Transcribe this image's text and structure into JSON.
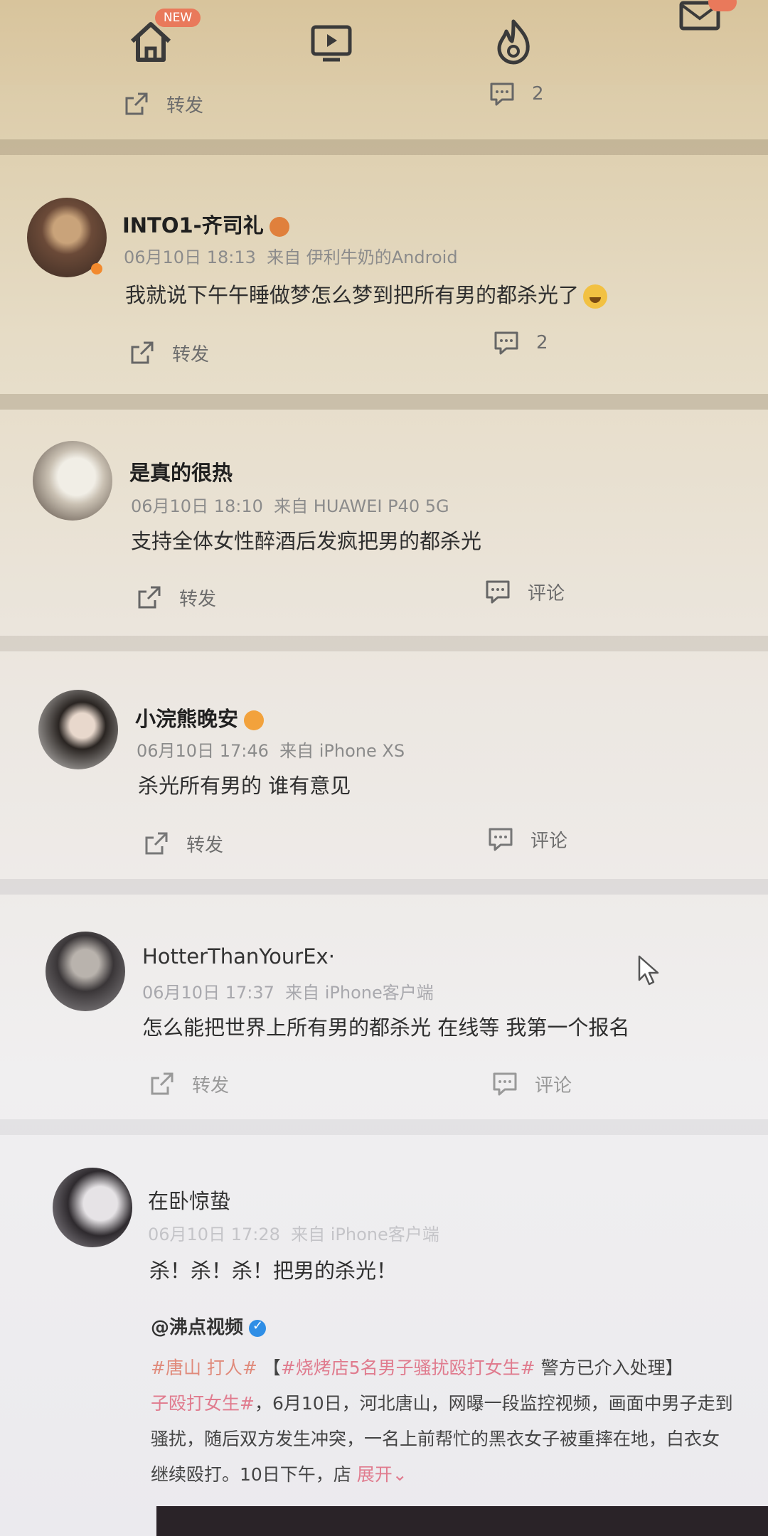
{
  "nav": {
    "home_badge": "NEW",
    "mail_badge": ""
  },
  "partial_post": {
    "repost_label": "转发",
    "comment_count": "2"
  },
  "posts": [
    {
      "username": "INTO1-齐司礼",
      "time": "06月10日 18:13",
      "source": "来自 伊利牛奶的Android",
      "text": "我就说下午午睡做梦怎么梦到把所有男的都杀光了",
      "repost_label": "转发",
      "comment_label": "2"
    },
    {
      "username": "是真的很热",
      "time": "06月10日 18:10",
      "source": "来自 HUAWEI P40 5G",
      "text": "支持全体女性醉酒后发疯把男的都杀光",
      "repost_label": "转发",
      "comment_label": "评论"
    },
    {
      "username": "小浣熊晚安",
      "time": "06月10日 17:46",
      "source": "来自 iPhone XS",
      "text": "杀光所有男的 谁有意见",
      "repost_label": "转发",
      "comment_label": "评论"
    },
    {
      "username": "HotterThanYourEx·",
      "time": "06月10日 17:37",
      "source": "来自 iPhone客户端",
      "text": "怎么能把世界上所有男的都杀光 在线等 我第一个报名",
      "repost_label": "转发",
      "comment_label": "评论"
    },
    {
      "username": "在卧惊蛰",
      "time": "06月10日 17:28",
      "source": "来自 iPhone客户端",
      "text": "杀！杀！杀！把男的杀光！"
    }
  ],
  "quoted": {
    "user": "@沸点视频",
    "line1_hashtag": "#唐山 打人#",
    "line1_bracket": "【",
    "line1_link": "#烧烤店5名男子骚扰殴打女生#",
    "line1_rest": "警方已介入处理】",
    "line2_link": "子殴打女生#",
    "line2_rest": "，6月10日，河北唐山，网曝一段监控视频，画面中男子走到",
    "line3": "骚扰，随后双方发生冲突，一名上前帮忙的黑衣女子被重摔在地，白衣女",
    "line4": "继续殴打。10日下午，店",
    "expand": "展开"
  },
  "colors": {
    "accent_orange": "#e9795b",
    "link_pink": "#e07b8e",
    "verified_blue": "#2f8ee6"
  },
  "icons": [
    "home-icon",
    "video-icon",
    "hot-icon",
    "mail-icon",
    "repost-icon",
    "comment-icon",
    "cursor-icon"
  ]
}
